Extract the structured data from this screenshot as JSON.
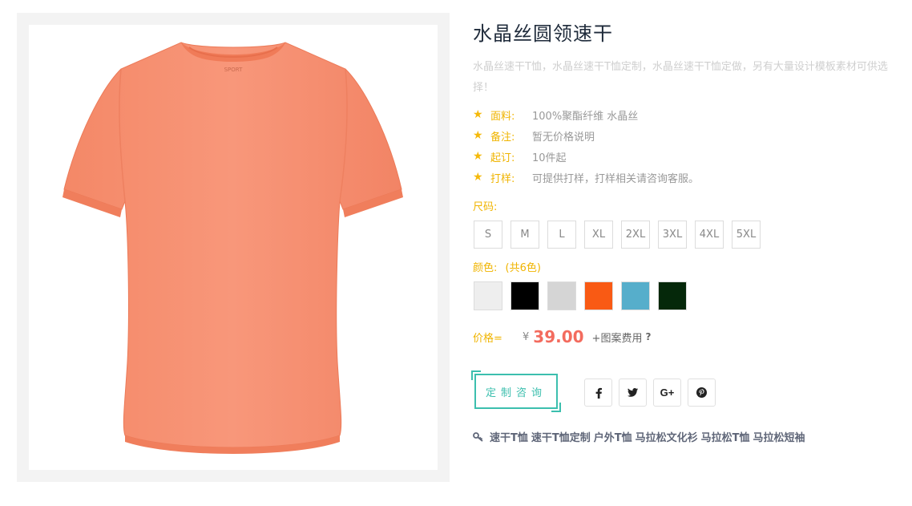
{
  "product": {
    "title": "水晶丝圆领速干",
    "description": "水晶丝速干T恤，水晶丝速干T恤定制，水晶丝速干T恤定做，另有大量设计模板素材可供选择！",
    "specs": [
      {
        "label": "面料:",
        "value": "100%聚酯纤维 水晶丝"
      },
      {
        "label": "备注:",
        "value": "暂无价格说明"
      },
      {
        "label": "起订:",
        "value": "10件起"
      },
      {
        "label": "打样:",
        "value": "可提供打样，打样相关请咨询客服。"
      }
    ],
    "size_label": "尺码:",
    "sizes": [
      "S",
      "M",
      "L",
      "XL",
      "2XL",
      "3XL",
      "4XL",
      "5XL"
    ],
    "color_label": "颜色:",
    "color_count": "(共6色)",
    "colors": [
      "#eeeeee",
      "#000000",
      "#d5d5d5",
      "#f95a14",
      "#56aecb",
      "#05280a"
    ],
    "price_label": "价格=",
    "currency": "¥",
    "price": "39.00",
    "extra_fee": "+图案费用",
    "help": "?",
    "consult_button": "定制咨询",
    "social": [
      {
        "name": "facebook-icon",
        "glyph": "f"
      },
      {
        "name": "twitter-icon",
        "glyph": "🐦"
      },
      {
        "name": "google-plus-icon",
        "glyph": "G+"
      },
      {
        "name": "pinterest-icon",
        "glyph": "℗"
      }
    ],
    "tags": [
      "速干T恤",
      "速干T恤定制",
      "户外T恤",
      "马拉松文化衫",
      "马拉松T恤",
      "马拉松短袖"
    ],
    "image_logo_text": "SPORT",
    "shirt_color": "#f7906f"
  },
  "colors": {
    "accent": "#3cbfae",
    "label": "#f0b400",
    "price": "#f36b5e"
  }
}
